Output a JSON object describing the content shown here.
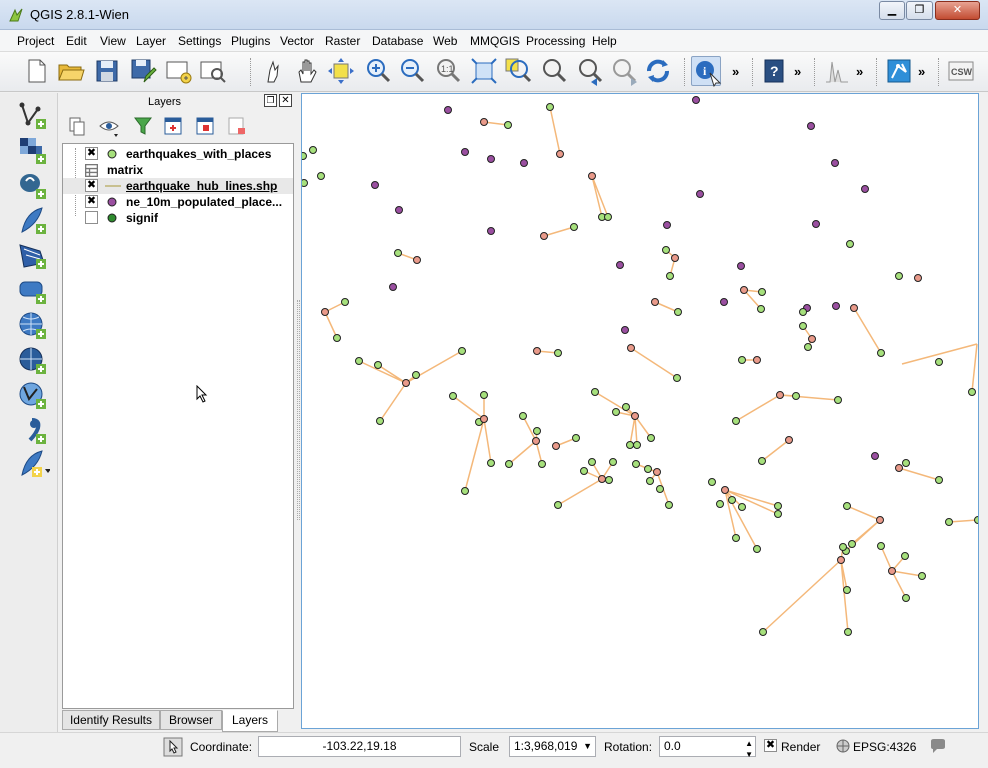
{
  "window": {
    "title": "QGIS 2.8.1-Wien"
  },
  "menu": [
    "Project",
    "Edit",
    "View",
    "Layer",
    "Settings",
    "Plugins",
    "Vector",
    "Raster",
    "Database",
    "Web",
    "MMQGIS",
    "Processing",
    "Help"
  ],
  "toolbar": {
    "items": [
      "new-project",
      "open-project",
      "save-project",
      "save-as",
      "new-print-composer",
      "composer-manager",
      "touch-zoom",
      "pan-map",
      "pan-to-selection",
      "zoom-in",
      "zoom-out",
      "zoom-native",
      "zoom-full",
      "zoom-to-selection",
      "zoom-to-layer",
      "zoom-last",
      "zoom-next",
      "refresh",
      "identify-features",
      "help-contents",
      "histogram",
      "georeferencer",
      "csw"
    ],
    "csw_label": "CSW",
    "more_glyph": "»"
  },
  "layers_panel": {
    "title": "Layers",
    "layers": [
      {
        "name": "earthquakes_with_places",
        "checked": true,
        "symbol": "point",
        "color": "#a6e07c"
      },
      {
        "name": "matrix",
        "checked": null,
        "symbol": "table",
        "color": ""
      },
      {
        "name": "earthquake_hub_lines.shp",
        "checked": true,
        "symbol": "line",
        "color": "#f4b87a",
        "selected": true
      },
      {
        "name": "ne_10m_populated_place...",
        "checked": true,
        "symbol": "point",
        "color": "#9a4fa0"
      },
      {
        "name": "signif",
        "checked": false,
        "symbol": "point",
        "color": "#2e8b2e"
      }
    ],
    "tabs": [
      {
        "label": "Identify Results",
        "active": false
      },
      {
        "label": "Browser",
        "active": false
      },
      {
        "label": "Layers",
        "active": true
      }
    ]
  },
  "statusbar": {
    "coordinate_label": "Coordinate:",
    "coordinate_value": "-103.22,19.18",
    "scale_label": "Scale",
    "scale_value": "1:3,968,019",
    "rotation_label": "Rotation:",
    "rotation_value": "0.0",
    "render_label": "Render",
    "render_checked": true,
    "crs": "EPSG:4326"
  },
  "colors": {
    "point_green": "#a6e07c",
    "point_purple": "#9a4fa0",
    "line_orange": "#f4b87a",
    "hub_pink": "#e99a8a"
  }
}
